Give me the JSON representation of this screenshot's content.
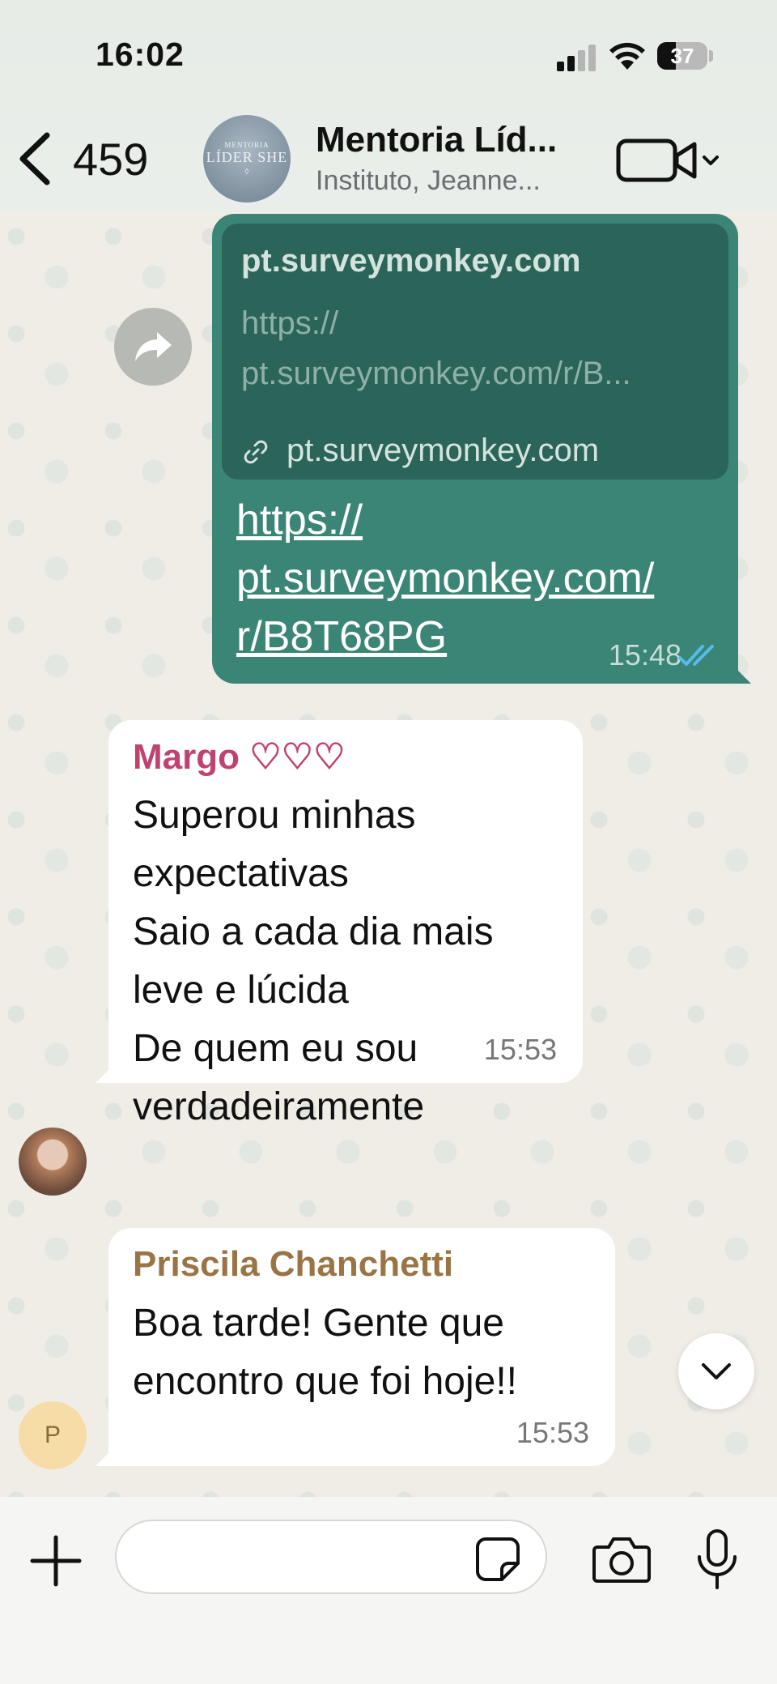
{
  "status_bar": {
    "time": "16:02",
    "battery": "37"
  },
  "header": {
    "back_count": "459",
    "avatar_lines": [
      "MENTORIA",
      "LÍDER SHE"
    ],
    "title": "Mentoria Líd...",
    "subtitle": "Instituto, Jeanne..."
  },
  "messages": [
    {
      "direction": "outgoing",
      "preview_title": "pt.surveymonkey.com",
      "preview_description": "https:// pt.surveymonkey.com/r/B...",
      "preview_domain": "pt.surveymonkey.com",
      "text": "https:// pt.surveymonkey.com/ r/B8T68PG",
      "time": "15:48"
    },
    {
      "direction": "incoming",
      "sender": "Margo ♡♡♡",
      "sender_color": "#c0436f",
      "text_lines": [
        "Superou minhas",
        "expectativas",
        "Saio a cada dia mais",
        "leve e lúcida",
        "De quem eu sou",
        "verdadeiramente"
      ],
      "time": "15:53"
    },
    {
      "direction": "incoming",
      "sender": "Priscila Chanchetti",
      "sender_color": "#9a7444",
      "avatar_letter": "P",
      "text_lines": [
        "Boa tarde! Gente que",
        "encontro que foi hoje!!"
      ],
      "time": "15:53"
    }
  ],
  "input": {
    "value": "",
    "placeholder": ""
  },
  "colors": {
    "outgoing_bubble": "#3b8577",
    "incoming_bubble": "#ffffff",
    "read_ticks": "#53bdeb"
  }
}
